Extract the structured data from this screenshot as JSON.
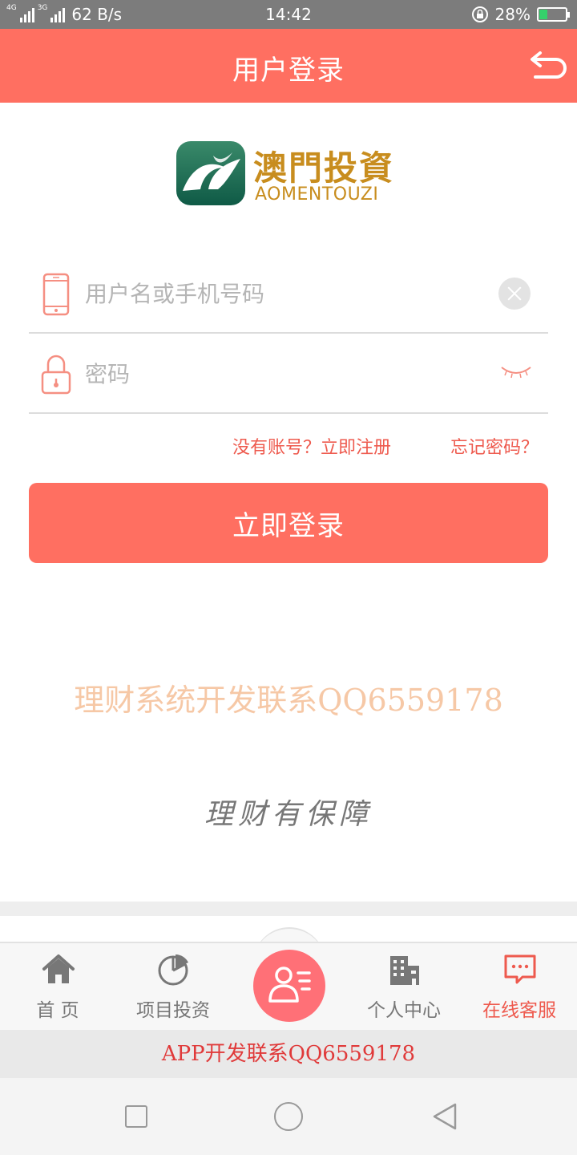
{
  "status_bar": {
    "network_left": "4G",
    "network_right": "3G",
    "speed": "62 B/s",
    "time": "14:42",
    "battery": "28%",
    "battery_level": 0.28
  },
  "header": {
    "title": "用户登录",
    "back_icon": "back-arrow-icon"
  },
  "logo": {
    "name_cn": "澳門投資",
    "name_en": "AOMENTOUZI"
  },
  "form": {
    "username_placeholder": "用户名或手机号码",
    "password_placeholder": "密码",
    "register_link": "没有账号？立即注册",
    "forgot_link": "忘记密码？",
    "login_button": "立即登录"
  },
  "promo_text": "理财系统开发联系QQ6559178",
  "slogan": "理财有保障",
  "tabbar": {
    "items": [
      {
        "label": "首 页",
        "icon": "home-icon"
      },
      {
        "label": "项目投资",
        "icon": "pie-chart-icon"
      },
      {
        "label": "",
        "icon": "user-card-icon"
      },
      {
        "label": "个人中心",
        "icon": "building-icon"
      },
      {
        "label": "在线客服",
        "icon": "chat-bubble-icon"
      }
    ],
    "active_color": "#ee5a4e"
  },
  "footer_text": "APP开发联系QQ6559178",
  "colors": {
    "accent": "#ff6f61",
    "link": "#ee5a4e",
    "logo_gold": "#c88d1e"
  }
}
